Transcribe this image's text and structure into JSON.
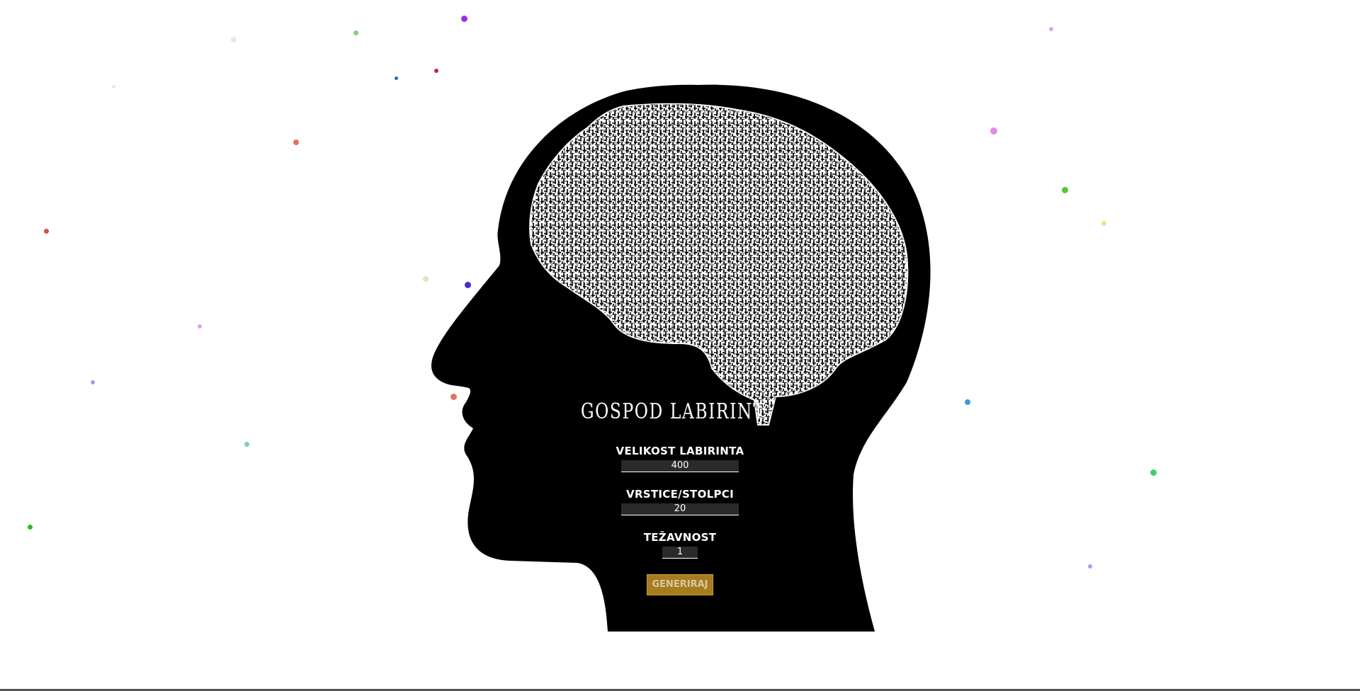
{
  "app": {
    "title": "GOSPOD LABIRINT"
  },
  "form": {
    "size_label": "VELIKOST LABIRINTA",
    "size_value": "400",
    "rows_label": "VRSTICE/STOLPCI",
    "rows_value": "20",
    "difficulty_label": "TEŽAVNOST",
    "difficulty_value": "1",
    "generate_label": "GENERIRAJ"
  },
  "colors": {
    "head": "#000000",
    "maze_path": "#ffffff",
    "button_bg": "#a67c1f",
    "button_text": "#d9c7a0"
  },
  "icons": {
    "head": "head-silhouette-icon",
    "maze": "brain-maze-icon"
  }
}
